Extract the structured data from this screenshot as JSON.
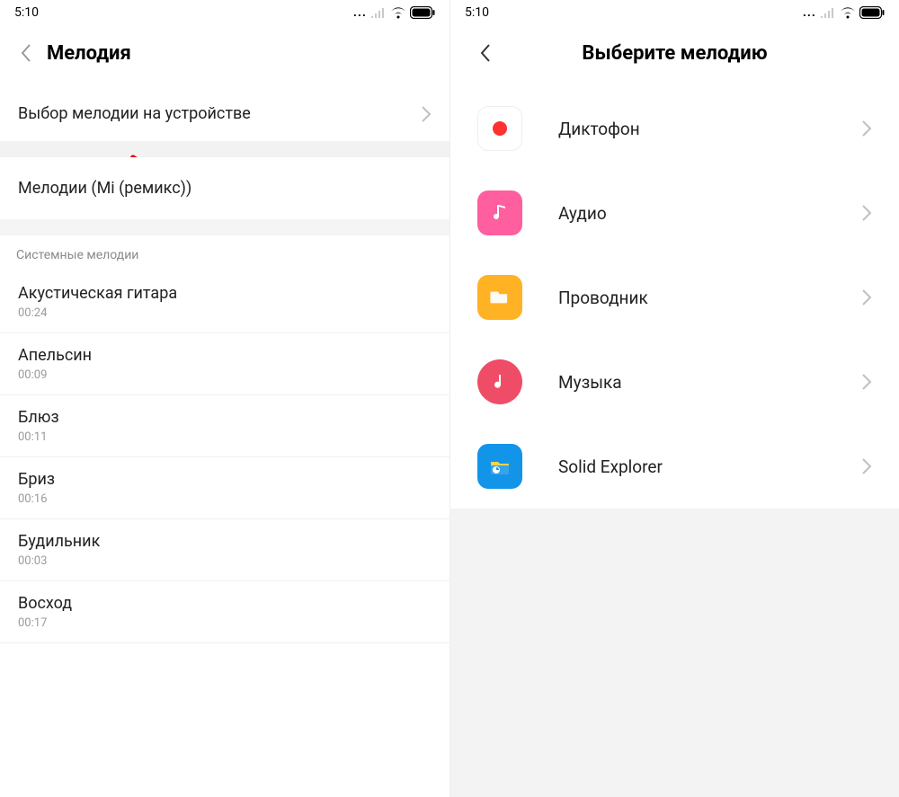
{
  "status": {
    "time": "5:10",
    "dots": "..."
  },
  "left": {
    "title": "Мелодия",
    "pick_on_device": "Выбор мелодии на устройстве",
    "mi_remix": "Мелодии (Mi (ремикс))",
    "system_header": "Системные мелодии",
    "items": [
      {
        "name": "Акустическая гитара",
        "dur": "00:24"
      },
      {
        "name": "Апельсин",
        "dur": "00:09"
      },
      {
        "name": "Блюз",
        "dur": "00:11"
      },
      {
        "name": "Бриз",
        "dur": "00:16"
      },
      {
        "name": "Будильник",
        "dur": "00:03"
      },
      {
        "name": "Восход",
        "dur": "00:17"
      }
    ]
  },
  "right": {
    "title": "Выберите мелодию",
    "apps": [
      {
        "name": "Диктофон",
        "icon": "recorder",
        "bg": "#ffffff",
        "border": "#eeeeee"
      },
      {
        "name": "Аудио",
        "icon": "audio",
        "bg": "#ff5f9e",
        "border": "transparent"
      },
      {
        "name": "Проводник",
        "icon": "files",
        "bg": "#ffb224",
        "border": "transparent"
      },
      {
        "name": "Музыка",
        "icon": "music",
        "bg": "#ef4c67",
        "border": "transparent",
        "circle": true
      },
      {
        "name": "Solid Explorer",
        "icon": "solid",
        "bg": "#1294e8",
        "border": "transparent"
      }
    ]
  }
}
